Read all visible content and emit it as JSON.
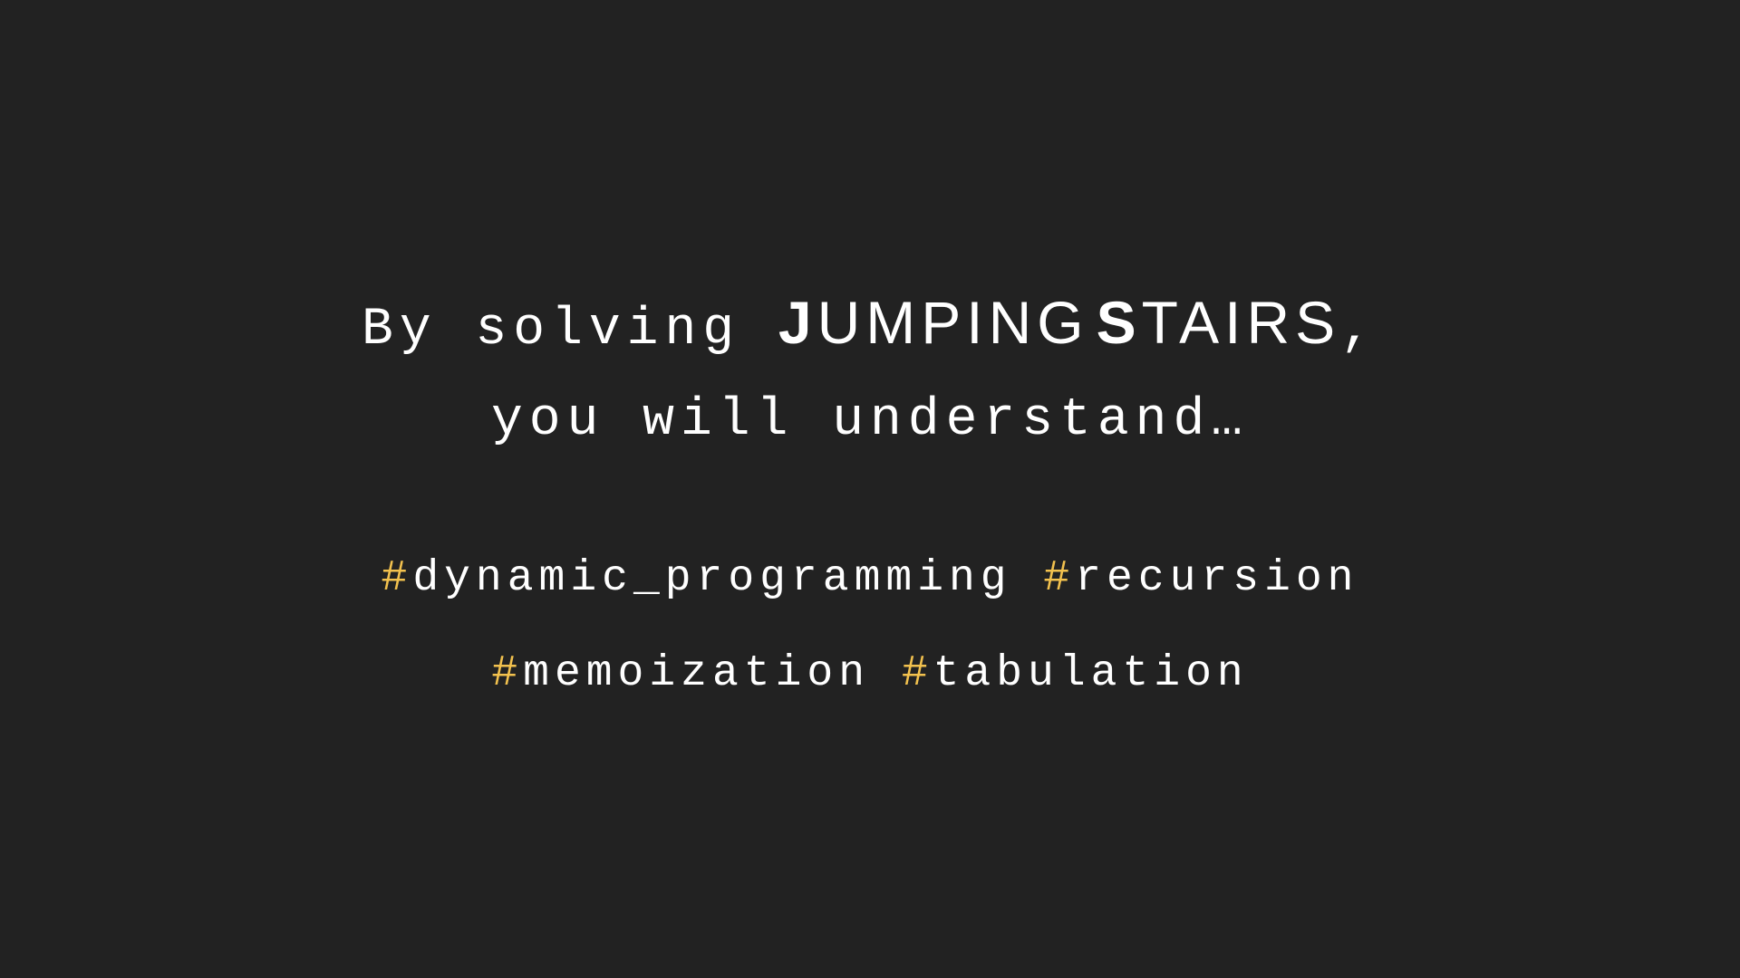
{
  "slide": {
    "line1": {
      "prefix": "By solving ",
      "word1_initial": "J",
      "word1_rest": "UMPING",
      "word2_initial": "S",
      "word2_rest": "TAIRS",
      "suffix": ","
    },
    "line2": "you will understand…",
    "hashtags_row1": [
      {
        "hash": "#",
        "tag": "dynamic_programming"
      },
      {
        "hash": "#",
        "tag": "recursion"
      }
    ],
    "hashtags_row2": [
      {
        "hash": "#",
        "tag": "memoization"
      },
      {
        "hash": "#",
        "tag": "tabulation"
      }
    ]
  },
  "colors": {
    "background": "#222222",
    "text": "#ffffff",
    "hash_accent": "#f2c14e"
  }
}
